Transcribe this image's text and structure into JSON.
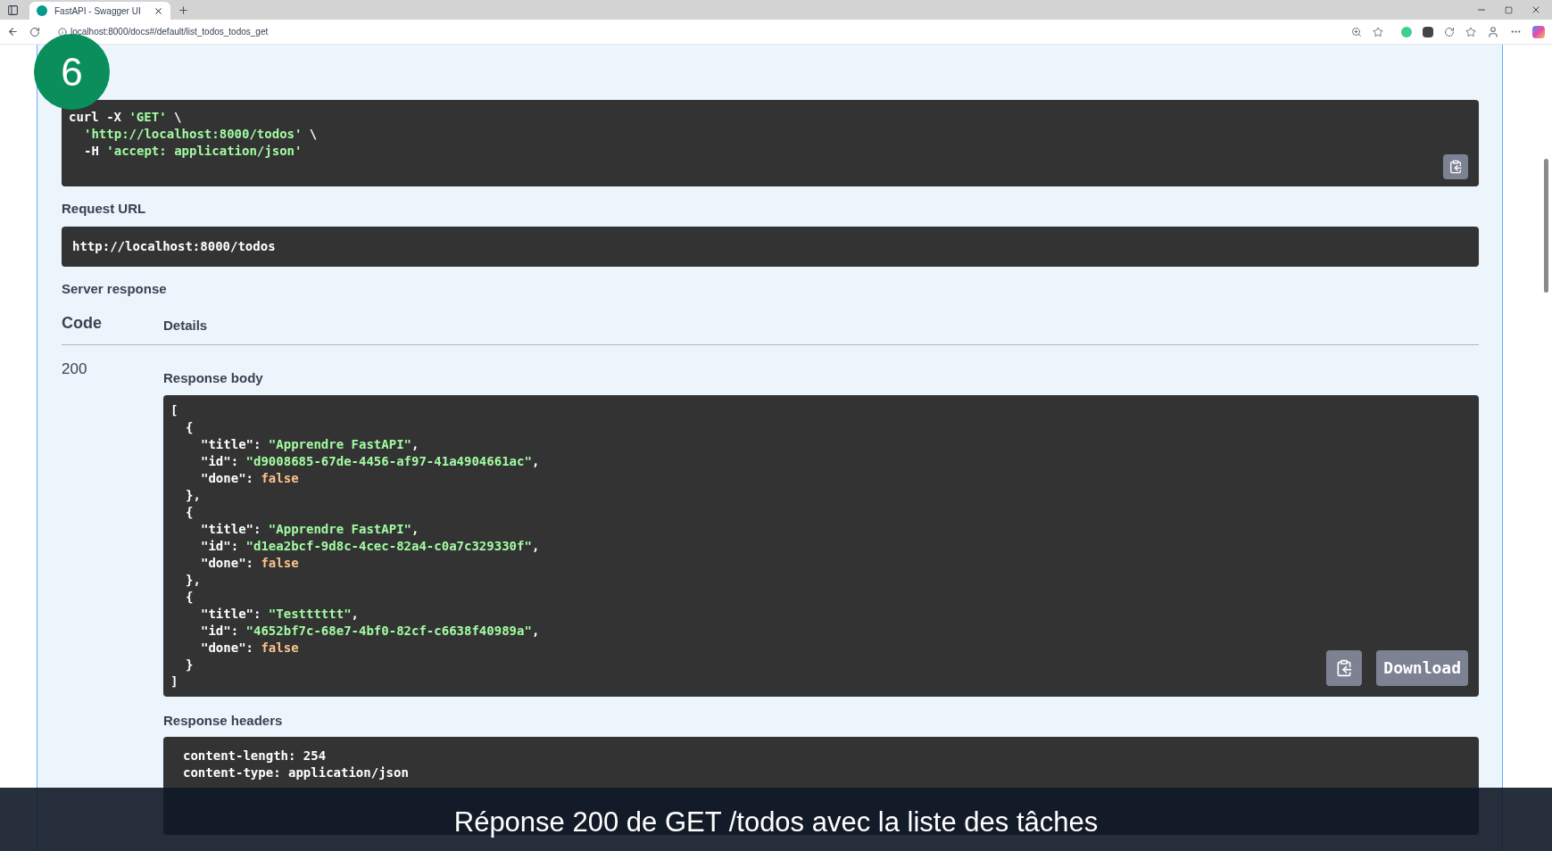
{
  "browser": {
    "tab_title": "FastAPI - Swagger UI",
    "address": "localhost:8000/docs#/default/list_todos_todos_get"
  },
  "step_badge": "6",
  "curl": {
    "lines": [
      {
        "kind": "top",
        "parts": [
          {
            "kind": "plain",
            "text": "curl -X "
          },
          {
            "kind": "string",
            "text": "'GET'"
          },
          {
            "kind": "plain",
            "text": " \\"
          }
        ]
      },
      {
        "kind": "nested",
        "parts": [
          {
            "kind": "string",
            "text": "'http://localhost:8000/todos'"
          },
          {
            "kind": "plain",
            "text": " \\"
          }
        ]
      },
      {
        "kind": "nested",
        "parts": [
          {
            "kind": "plain",
            "text": "-H "
          },
          {
            "kind": "string",
            "text": "'accept: application/json'"
          }
        ]
      }
    ]
  },
  "request_url": {
    "label": "Request URL",
    "value": "http://localhost:8000/todos"
  },
  "server_response": {
    "label": "Server response",
    "columns": [
      "Code",
      "Details"
    ],
    "code": "200",
    "body_label": "Response body",
    "body_lines": [
      {
        "kind": "top",
        "parts": [
          {
            "kind": "plain",
            "text": "["
          }
        ]
      },
      {
        "kind": "nested",
        "parts": [
          {
            "kind": "plain",
            "text": "{"
          }
        ]
      },
      {
        "kind": "field",
        "parts": [
          {
            "kind": "plain",
            "text": "\"title\": "
          },
          {
            "kind": "string",
            "text": "\"Apprendre FastAPI\""
          },
          {
            "kind": "plain",
            "text": ","
          }
        ]
      },
      {
        "kind": "field",
        "parts": [
          {
            "kind": "plain",
            "text": "\"id\": "
          },
          {
            "kind": "string",
            "text": "\"d9008685-67de-4456-af97-41a4904661ac\""
          },
          {
            "kind": "plain",
            "text": ","
          }
        ]
      },
      {
        "kind": "field",
        "parts": [
          {
            "kind": "plain",
            "text": "\"done\": "
          },
          {
            "kind": "literal",
            "text": "false"
          }
        ]
      },
      {
        "kind": "nested",
        "parts": [
          {
            "kind": "plain",
            "text": "},"
          }
        ]
      },
      {
        "kind": "nested",
        "parts": [
          {
            "kind": "plain",
            "text": "{"
          }
        ]
      },
      {
        "kind": "field",
        "parts": [
          {
            "kind": "plain",
            "text": "\"title\": "
          },
          {
            "kind": "string",
            "text": "\"Apprendre FastAPI\""
          },
          {
            "kind": "plain",
            "text": ","
          }
        ]
      },
      {
        "kind": "field",
        "parts": [
          {
            "kind": "plain",
            "text": "\"id\": "
          },
          {
            "kind": "string",
            "text": "\"d1ea2bcf-9d8c-4cec-82a4-c0a7c329330f\""
          },
          {
            "kind": "plain",
            "text": ","
          }
        ]
      },
      {
        "kind": "field",
        "parts": [
          {
            "kind": "plain",
            "text": "\"done\": "
          },
          {
            "kind": "literal",
            "text": "false"
          }
        ]
      },
      {
        "kind": "nested",
        "parts": [
          {
            "kind": "plain",
            "text": "},"
          }
        ]
      },
      {
        "kind": "nested",
        "parts": [
          {
            "kind": "plain",
            "text": "{"
          }
        ]
      },
      {
        "kind": "field",
        "parts": [
          {
            "kind": "plain",
            "text": "\"title\": "
          },
          {
            "kind": "string",
            "text": "\"Testttttt\""
          },
          {
            "kind": "plain",
            "text": ","
          }
        ]
      },
      {
        "kind": "field",
        "parts": [
          {
            "kind": "plain",
            "text": "\"id\": "
          },
          {
            "kind": "string",
            "text": "\"4652bf7c-68e7-4bf0-82cf-c6638f40989a\""
          },
          {
            "kind": "plain",
            "text": ","
          }
        ]
      },
      {
        "kind": "field",
        "parts": [
          {
            "kind": "plain",
            "text": "\"done\": "
          },
          {
            "kind": "literal",
            "text": "false"
          }
        ]
      },
      {
        "kind": "nested",
        "parts": [
          {
            "kind": "plain",
            "text": "}"
          }
        ]
      },
      {
        "kind": "top",
        "parts": [
          {
            "kind": "plain",
            "text": "]"
          }
        ]
      }
    ],
    "download": "Download",
    "headers_label": "Response headers",
    "header_lines": [
      "content-length: 254",
      "content-type: application/json"
    ]
  },
  "caption": "Réponse 200 de GET /todos avec la liste des tâches"
}
